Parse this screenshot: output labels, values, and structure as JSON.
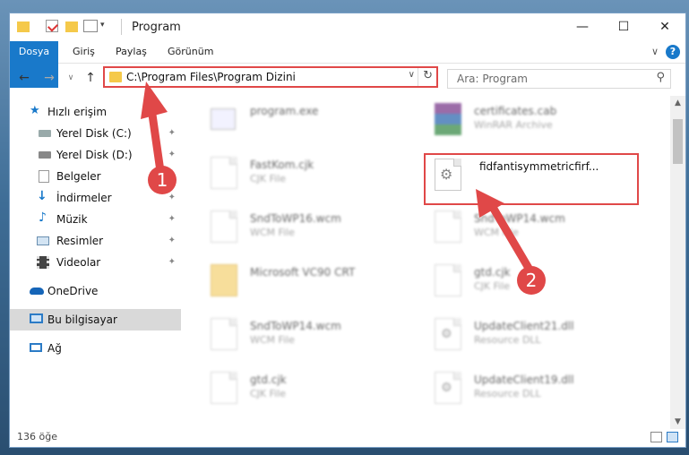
{
  "window": {
    "title": "Program",
    "controls": {
      "minimize": "—",
      "maximize": "☐",
      "close": "✕"
    }
  },
  "ribbon": {
    "tabs": [
      "Dosya",
      "Giriş",
      "Paylaş",
      "Görünüm"
    ],
    "expand": "∨",
    "help": "?"
  },
  "nav": {
    "back": "←",
    "forward": "→",
    "recent": "∨",
    "up": "↑",
    "address": "C:\\Program Files\\Program Dizini",
    "address_dropdown": "∨",
    "refresh": "↻",
    "search_placeholder": "Ara: Program",
    "search_icon": "⚲"
  },
  "sidebar": {
    "items": [
      {
        "label": "Hızlı erişim",
        "icon": "star-icon"
      },
      {
        "label": "Yerel Disk (C:)",
        "icon": "drive-icon",
        "pin": "✦"
      },
      {
        "label": "Yerel Disk (D:)",
        "icon": "drive-icon",
        "pin": "✦"
      },
      {
        "label": "Belgeler",
        "icon": "documents-icon",
        "pin": "✦"
      },
      {
        "label": "İndirmeler",
        "icon": "download-icon",
        "pin": "✦"
      },
      {
        "label": "Müzik",
        "icon": "music-icon",
        "pin": "✦"
      },
      {
        "label": "Resimler",
        "icon": "pictures-icon",
        "pin": "✦"
      },
      {
        "label": "Videolar",
        "icon": "videos-icon",
        "pin": "✦"
      },
      {
        "label": "OneDrive",
        "icon": "cloud-icon"
      },
      {
        "label": "Bu bilgisayar",
        "icon": "computer-icon"
      },
      {
        "label": "Ağ",
        "icon": "network-icon"
      }
    ]
  },
  "files": [
    {
      "name": "program.exe",
      "type": ""
    },
    {
      "name": "certificates.cab",
      "type": "WinRAR Archive"
    },
    {
      "name": "FastKom.cjk",
      "type": "CJK File"
    },
    {
      "name": "fidfantisymmetricfirf...",
      "type": ""
    },
    {
      "name": "SndToWP16.wcm",
      "type": "WCM File"
    },
    {
      "name": "SndToWP14.wcm",
      "type": "WCM File"
    },
    {
      "name": "Microsoft VC90 CRT",
      "type": ""
    },
    {
      "name": "gtd.cjk",
      "type": "CJK File"
    },
    {
      "name": "SndToWP14.wcm",
      "type": "WCM File"
    },
    {
      "name": "UpdateClient21.dll",
      "type": "Resource DLL"
    },
    {
      "name": "gtd.cjk",
      "type": "CJK File"
    },
    {
      "name": "UpdateClient19.dll",
      "type": "Resource DLL"
    }
  ],
  "status": {
    "count": "136 öğe"
  },
  "callouts": [
    "1",
    "2"
  ],
  "colors": {
    "accent": "#1979ca",
    "highlight": "#e04848",
    "folder": "#f5c94a"
  }
}
